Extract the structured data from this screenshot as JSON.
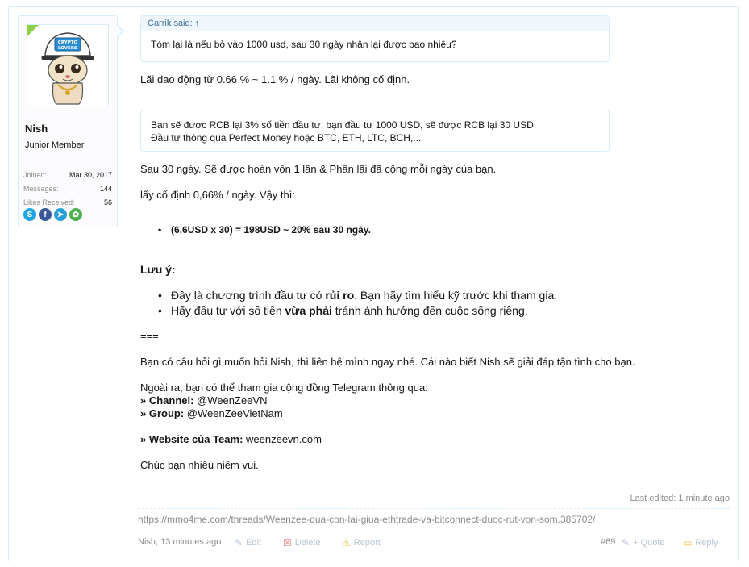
{
  "user": {
    "name": "Nish",
    "title": "Junior Member",
    "avatar_badge_text": "CRYPTO LOVERS",
    "stats": [
      {
        "label": "Joined:",
        "value": "Mar 30, 2017"
      },
      {
        "label": "Messages:",
        "value": "144"
      },
      {
        "label": "Likes Received:",
        "value": "56"
      }
    ],
    "socials": [
      {
        "icon": "skype-icon",
        "glyph": "S",
        "color": "#1ea3e6"
      },
      {
        "icon": "facebook-icon",
        "glyph": "f",
        "color": "#3b5998"
      },
      {
        "icon": "telegram-icon",
        "glyph": "➤",
        "color": "#2aa0da"
      },
      {
        "icon": "icq-icon",
        "glyph": "✿",
        "color": "#4caf50"
      }
    ]
  },
  "quote1": {
    "author": "Carrik said: ↑",
    "text": "Tóm lại là nếu bỏ vào 1000 usd, sau 30 ngày nhận lại được bao nhiêu?"
  },
  "reply_line1": "Lãi dao động từ 0.66 % ~ 1.1 % / ngày. Lãi không cố định.",
  "quote2": {
    "line1": "Bạn sẽ được RCB lại 3% số tiền đầu tư, bạn đầu tư 1000 USD, sẽ được RCB lại 30 USD",
    "line2": "Đầu tư thông qua Perfect Money hoặc BTC, ETH, LTC, BCH,..."
  },
  "para1": "Sau 30 ngày. Sẽ được hoàn vốn 1 lần & Phần lãi đã cộng mỗi ngày của bạn.",
  "para2": "lấy cố định 0,66% / ngày. Vậy thì:",
  "bullet_calc": "(6.6USD x 30) = 198USD ~ 20% sau 30 ngày.",
  "note_heading": "Lưu ý:",
  "note_items": [
    {
      "pre": "Đây là chương trình đầu tư có ",
      "bold": "rủi ro",
      "post": ". Bạn hãy tìm hiểu kỹ trước khi tham gia."
    },
    {
      "pre": "Hãy đầu tư với số tiền ",
      "bold": "vừa phải",
      "post": " tránh ảnh hưởng đến cuộc sống riêng."
    }
  ],
  "separator": "===",
  "para3": "Bạn có câu hỏi gì muốn hỏi Nish, thì liên hệ mình ngay nhé. Cái nào biết Nish sẽ giải đáp tận tình cho bạn.",
  "para4": "Ngoài ra, bạn có thể tham gia cộng đồng Telegram thông qua:",
  "channel_label": "» Channel:",
  "channel_value": " @WeenZeeVN",
  "group_label": "» Group:",
  "group_value": " @WeenZeeVietNam",
  "website_label": "» Website của Team:",
  "website_value": " weenzeevn.com",
  "closing": "Chúc bạn nhiều niềm vui.",
  "last_edited": "Last edited: 1 minute ago",
  "permalink": "https://mmo4me.com/threads/Weenzee-dua-con-lai-giua-ethtrade-va-bitconnect-duoc-rut-von-som.385702/",
  "footer": {
    "author_time": "Nish, 13 minutes ago",
    "edit": "Edit",
    "delete": "Delete",
    "report": "Report",
    "post_number": "#69",
    "quote": "+ Quote",
    "reply": "Reply"
  }
}
